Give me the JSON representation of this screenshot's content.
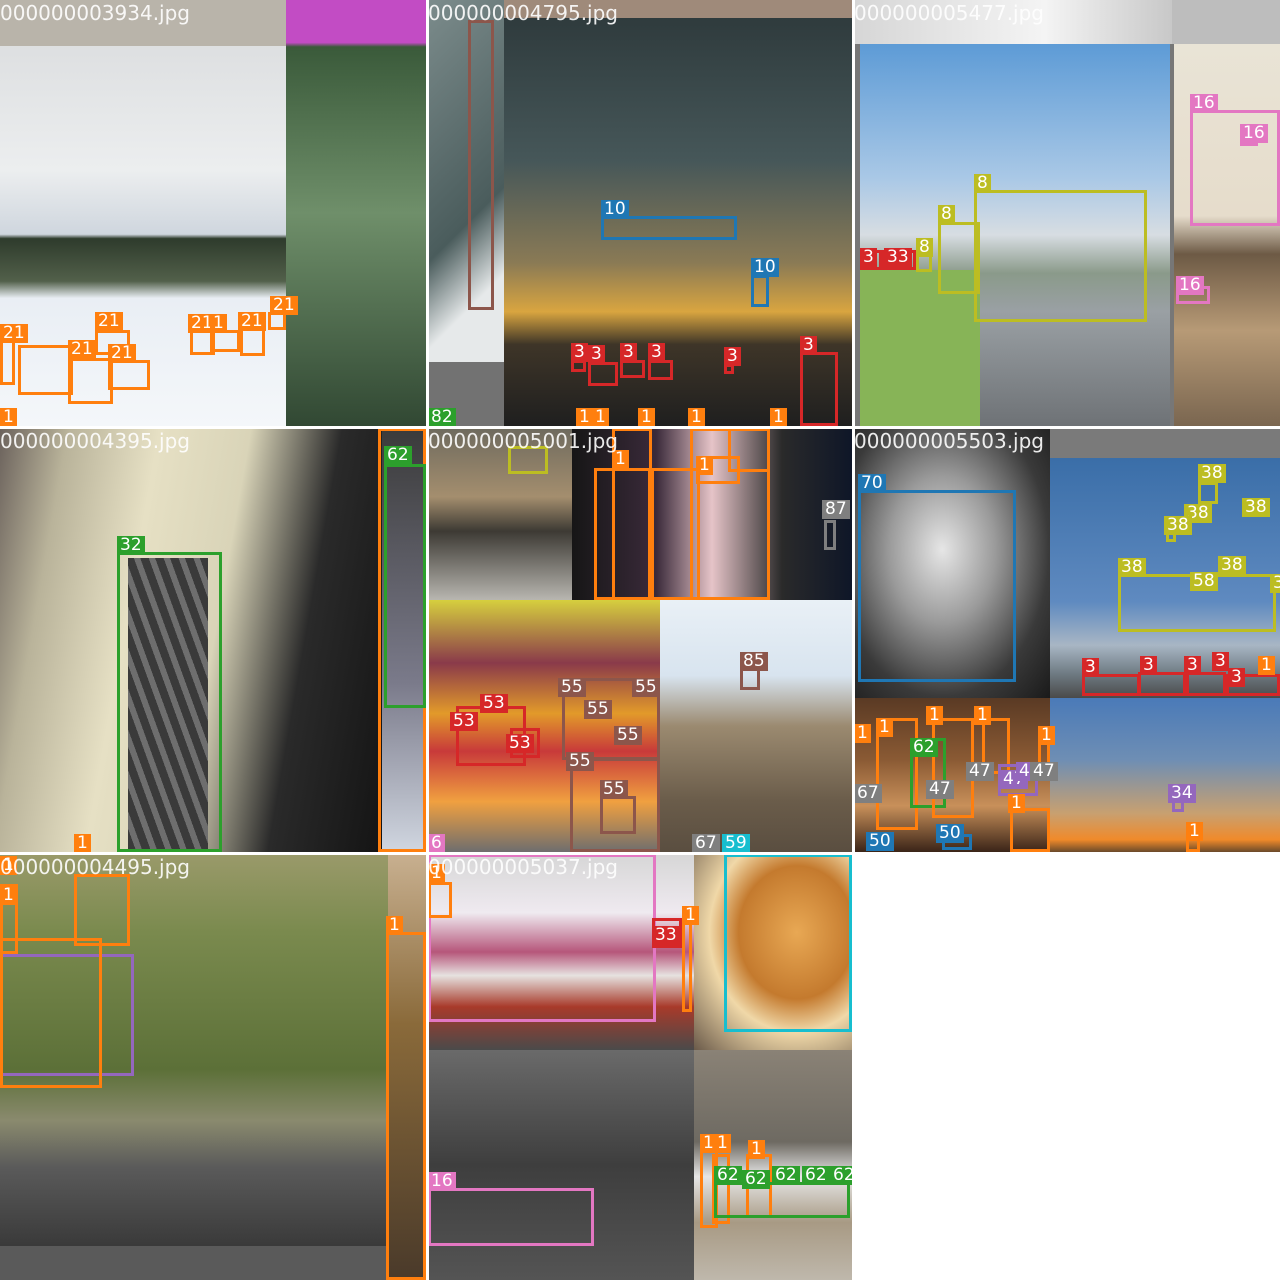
{
  "palette": {
    "orange": "#ff7f0e",
    "blue": "#1f77b4",
    "red": "#d62728",
    "green": "#2ca02c",
    "olive": "#bcbd22",
    "pink": "#e377c2",
    "purple": "#9467bd",
    "brown": "#8c564b",
    "cyan": "#17becf",
    "gray": "#7f7f7f"
  },
  "tiles": [
    {
      "filename": "000000003934.jpg"
    },
    {
      "filename": "000000004795.jpg"
    },
    {
      "filename": "000000005477.jpg"
    },
    {
      "filename": "000000004395.jpg"
    },
    {
      "filename": "000000005001.jpg"
    },
    {
      "filename": "000000005503.jpg"
    },
    {
      "filename": "000000004495.jpg"
    },
    {
      "filename": "000000005037.jpg"
    }
  ],
  "detection_labels": [
    "1",
    "3",
    "6",
    "8",
    "10",
    "16",
    "21",
    "32",
    "33",
    "34",
    "38",
    "47",
    "50",
    "53",
    "55",
    "58",
    "59",
    "62",
    "67",
    "70",
    "82",
    "85",
    "87"
  ]
}
